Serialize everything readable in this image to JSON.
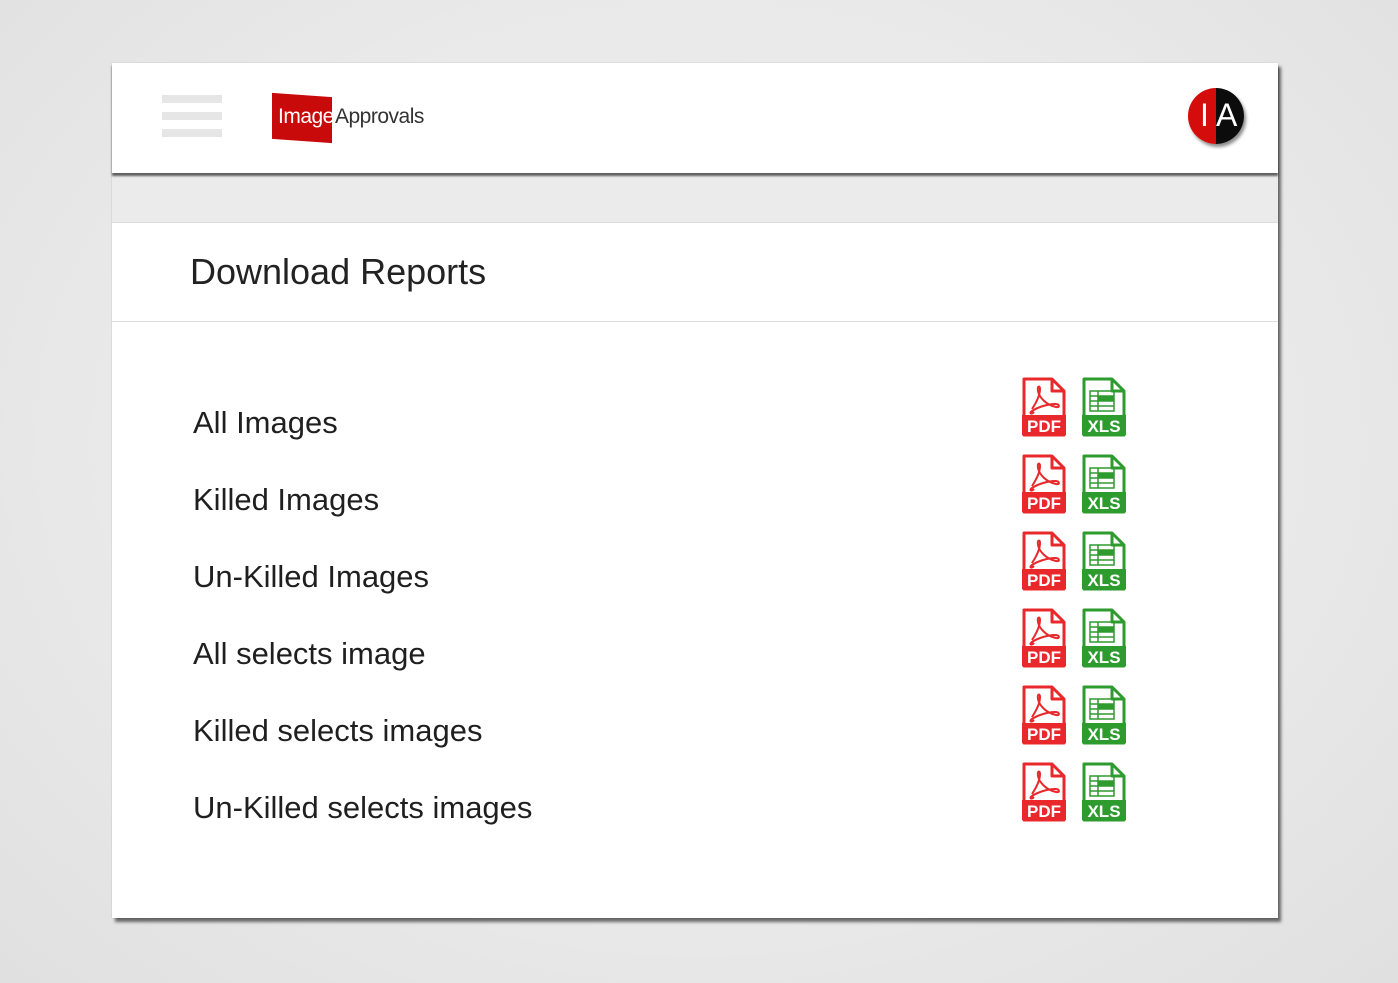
{
  "header": {
    "menu_icon": "hamburger-menu-icon",
    "logo": {
      "part1": "Image",
      "part2": "Approvals"
    },
    "avatar": {
      "letter1": "I",
      "letter2": "A"
    }
  },
  "page": {
    "title": "Download Reports"
  },
  "icons": {
    "pdf_text": "PDF",
    "xls_text": "XLS"
  },
  "colors": {
    "pdf": "#e8282b",
    "xls": "#2e9b2e",
    "brand": "#c80a0a"
  },
  "reports": [
    {
      "label": "All Images"
    },
    {
      "label": "Killed Images"
    },
    {
      "label": "Un-Killed Images"
    },
    {
      "label": "All selects image"
    },
    {
      "label": "Killed selects images"
    },
    {
      "label": "Un-Killed selects images"
    }
  ]
}
